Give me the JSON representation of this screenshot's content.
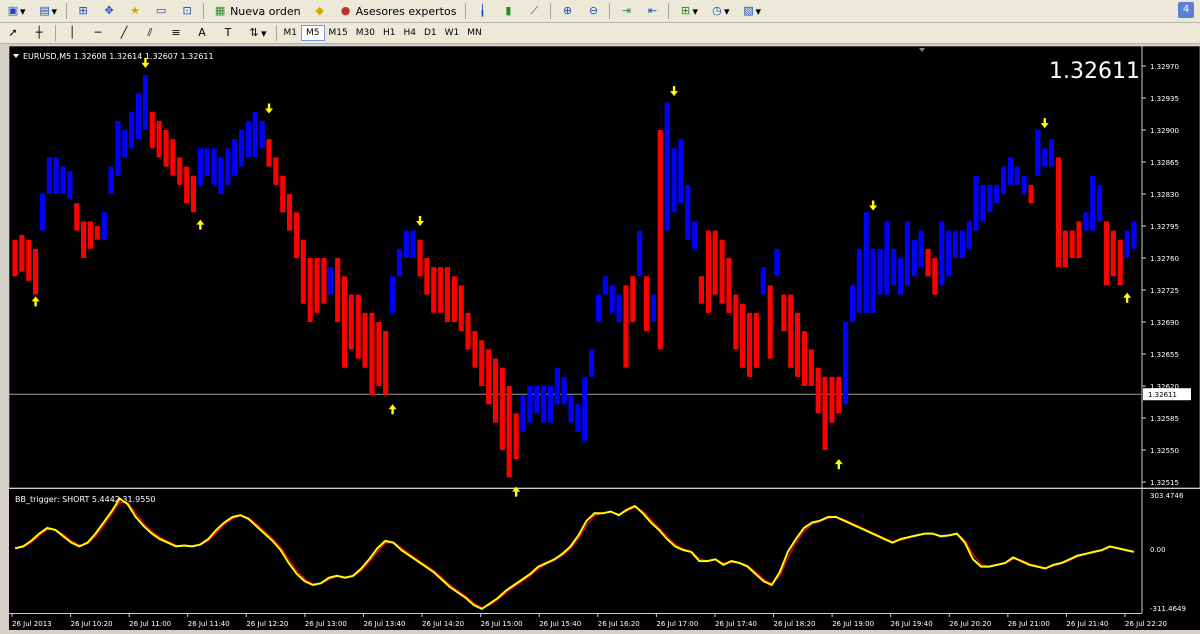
{
  "toolbar": {
    "new_order": "Nueva orden",
    "experts": "Asesores expertos",
    "badge": "4"
  },
  "timeframes": [
    "M1",
    "M5",
    "M15",
    "M30",
    "H1",
    "H4",
    "D1",
    "W1",
    "MN"
  ],
  "active_timeframe": "M5",
  "chart": {
    "header": "EURUSD,M5  1.32608 1.32614 1.32607 1.32611",
    "big_price": "1.32611",
    "current_price_label": "1.32611",
    "current_price": 1.32611,
    "price_axis": [
      "1.32970",
      "1.32935",
      "1.32900",
      "1.32865",
      "1.32830",
      "1.32795",
      "1.32760",
      "1.32725",
      "1.32690",
      "1.32655",
      "1.32620",
      "1.32585",
      "1.32550",
      "1.32515"
    ],
    "colors": {
      "up": "#0000ff",
      "down": "#ff0000",
      "arrow": "#ffff00",
      "bg": "#000000"
    }
  },
  "indicator": {
    "header": "BB_trigger: SHORT 5.4442 31.9550",
    "axis": [
      "303.4746",
      "0.00",
      "-311.4649"
    ]
  },
  "time_axis": [
    "26 Jul 2013",
    "26 Jul 10:20",
    "26 Jul 11:00",
    "26 Jul 11:40",
    "26 Jul 12:20",
    "26 Jul 13:00",
    "26 Jul 13:40",
    "26 Jul 14:20",
    "26 Jul 15:00",
    "26 Jul 15:40",
    "26 Jul 16:20",
    "26 Jul 17:00",
    "26 Jul 17:40",
    "26 Jul 18:20",
    "26 Jul 19:00",
    "26 Jul 19:40",
    "26 Jul 20:20",
    "26 Jul 21:00",
    "26 Jul 21:40",
    "26 Jul 22:20"
  ]
}
